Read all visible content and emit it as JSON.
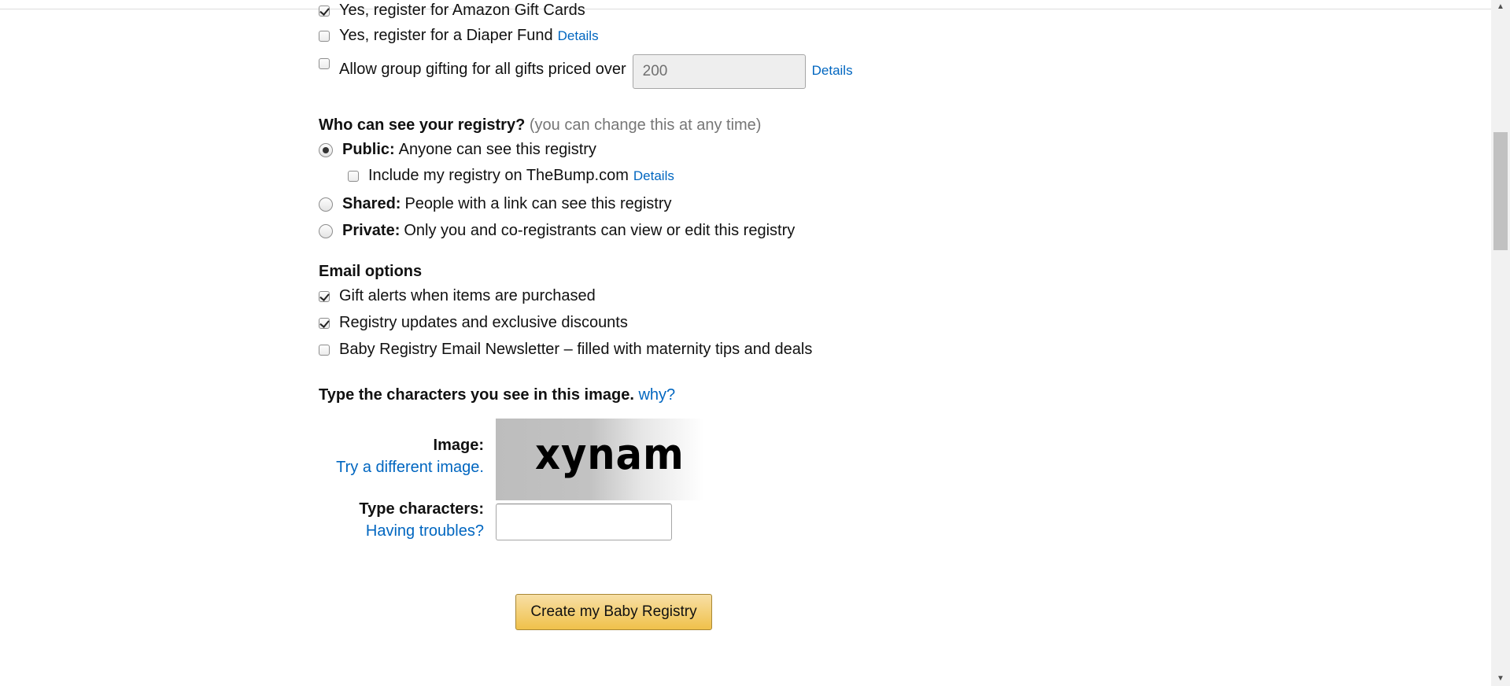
{
  "registry_options": {
    "gift_cards_label": "Yes, register for Amazon Gift Cards",
    "gift_cards_checked": true,
    "diaper_fund_label": "Yes, register for a Diaper Fund",
    "diaper_fund_checked": false,
    "diaper_fund_details": "Details",
    "group_gifting_label": "Allow group gifting for all gifts priced over",
    "group_gifting_checked": false,
    "group_gifting_amount": "200",
    "group_gifting_details": "Details"
  },
  "visibility": {
    "title": "Who can see your registry?",
    "hint": "(you can change this at any time)",
    "public_label": "Public:",
    "public_desc": "Anyone can see this registry",
    "public_selected": true,
    "thebump_label": "Include my registry on TheBump.com",
    "thebump_checked": false,
    "thebump_details": "Details",
    "shared_label": "Shared:",
    "shared_desc": "People with a link can see this registry",
    "private_label": "Private:",
    "private_desc": "Only you and co-registrants can view or edit this registry"
  },
  "email_options": {
    "title": "Email options",
    "items": [
      {
        "label": "Gift alerts when items are purchased",
        "checked": true
      },
      {
        "label": "Registry updates and exclusive discounts",
        "checked": true
      },
      {
        "label": "Baby Registry Email Newsletter – filled with maternity tips and deals",
        "checked": false
      }
    ]
  },
  "captcha": {
    "prompt": "Type the characters you see in this image.",
    "why_link": "why?",
    "image_label": "Image:",
    "try_different": "Try a different image.",
    "image_text": "xynam",
    "type_label": "Type characters:",
    "having_troubles": "Having troubles?",
    "input_value": ""
  },
  "submit": {
    "label": "Create my Baby Registry"
  },
  "colors": {
    "link": "#0066c0",
    "button_top": "#f7dfa5",
    "button_bottom": "#f0c14b",
    "button_border": "#a88734"
  }
}
